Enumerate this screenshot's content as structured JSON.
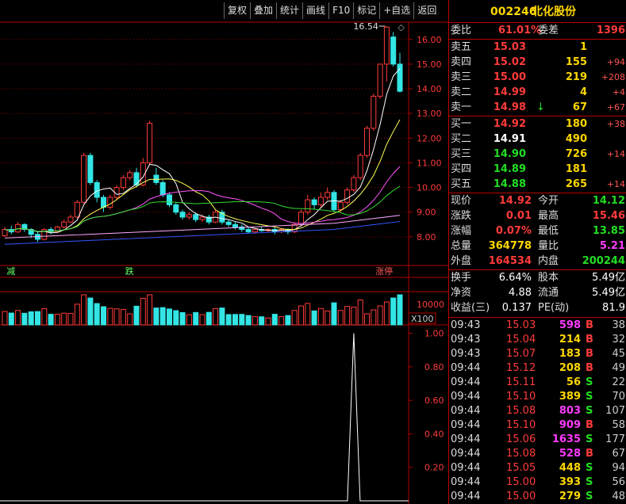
{
  "toolbar": [
    "复权",
    "叠加",
    "统计",
    "画线",
    "F10",
    "标记",
    "+自选",
    "返回"
  ],
  "stock": {
    "code": "002246",
    "name": "北化股份"
  },
  "weibi": {
    "label1": "委比",
    "value1": "61.01%",
    "label2": "委差",
    "value2": "1396"
  },
  "sells": [
    {
      "label": "卖五",
      "price": "15.03",
      "vol": "1",
      "chg": ""
    },
    {
      "label": "卖四",
      "price": "15.02",
      "vol": "155",
      "chg": "+94"
    },
    {
      "label": "卖三",
      "price": "15.00",
      "vol": "219",
      "chg": "+208"
    },
    {
      "label": "卖二",
      "price": "14.99",
      "vol": "4",
      "chg": "+4"
    },
    {
      "label": "卖一",
      "price": "14.98",
      "vol": "67",
      "chg": "+67",
      "arrow": "↓"
    }
  ],
  "buys": [
    {
      "label": "买一",
      "price": "14.92",
      "vol": "180",
      "chg": "+38"
    },
    {
      "label": "买二",
      "price": "14.91",
      "vol": "490",
      "chg": ""
    },
    {
      "label": "买三",
      "price": "14.90",
      "vol": "726",
      "chg": "+14"
    },
    {
      "label": "买四",
      "price": "14.89",
      "vol": "181",
      "chg": ""
    },
    {
      "label": "买五",
      "price": "14.88",
      "vol": "265",
      "chg": "+14"
    }
  ],
  "quote": {
    "xj_l": "现价",
    "xj": "14.92",
    "jk_l": "今开",
    "jk": "14.12",
    "zd_l": "涨跌",
    "zd": "0.01",
    "zg_l": "最高",
    "zg": "15.46",
    "zf_l": "涨幅",
    "zf": "0.07%",
    "zdi_l": "最低",
    "zdi": "13.85",
    "zl_l": "总量",
    "zl": "364778",
    "lb_l": "量比",
    "lb": "5.21",
    "wp_l": "外盘",
    "wp": "164534",
    "np_l": "内盘",
    "np": "200244"
  },
  "fund": {
    "hs_l": "换手",
    "hs": "6.64%",
    "gb_l": "股本",
    "gb": "5.49亿",
    "jz_l": "净资",
    "jz": "4.88",
    "lt_l": "流通",
    "lt": "5.49亿",
    "sy_l": "收益(三)",
    "sy": "0.137",
    "pe_l": "PE(动)",
    "pe": "81.9"
  },
  "ticks": [
    {
      "t": "09:43",
      "p": "15.03",
      "v": "598",
      "f": "B",
      "n": "38",
      "pc": "red",
      "vc": "magenta"
    },
    {
      "t": "09:43",
      "p": "15.04",
      "v": "214",
      "f": "B",
      "n": "32",
      "pc": "red",
      "vc": "yellow"
    },
    {
      "t": "09:43",
      "p": "15.07",
      "v": "183",
      "f": "B",
      "n": "45",
      "pc": "red",
      "vc": "yellow"
    },
    {
      "t": "09:44",
      "p": "15.12",
      "v": "208",
      "f": "B",
      "n": "49",
      "pc": "red",
      "vc": "yellow"
    },
    {
      "t": "09:44",
      "p": "15.11",
      "v": "56",
      "f": "S",
      "n": "22",
      "pc": "red",
      "vc": "yellow"
    },
    {
      "t": "09:44",
      "p": "15.10",
      "v": "389",
      "f": "S",
      "n": "70",
      "pc": "red",
      "vc": "yellow"
    },
    {
      "t": "09:44",
      "p": "15.08",
      "v": "803",
      "f": "S",
      "n": "107",
      "pc": "red",
      "vc": "magenta"
    },
    {
      "t": "09:44",
      "p": "15.10",
      "v": "909",
      "f": "B",
      "n": "58",
      "pc": "red",
      "vc": "magenta"
    },
    {
      "t": "09:44",
      "p": "15.06",
      "v": "1635",
      "f": "S",
      "n": "177",
      "pc": "red",
      "vc": "magenta"
    },
    {
      "t": "09:44",
      "p": "15.08",
      "v": "528",
      "f": "B",
      "n": "67",
      "pc": "red",
      "vc": "magenta"
    },
    {
      "t": "09:44",
      "p": "15.05",
      "v": "448",
      "f": "S",
      "n": "94",
      "pc": "red",
      "vc": "yellow"
    },
    {
      "t": "09:44",
      "p": "15.00",
      "v": "393",
      "f": "S",
      "n": "56",
      "pc": "red",
      "vc": "yellow"
    },
    {
      "t": "09:44",
      "p": "15.00",
      "v": "279",
      "f": "S",
      "n": "48",
      "pc": "red",
      "vc": "yellow"
    }
  ],
  "colors": {
    "up": "#ff3b3b",
    "down": "#33e5e5",
    "grid": "#8b0000",
    "axis": "#b00000"
  },
  "chart_data": {
    "type": "candlestick",
    "price_axis": {
      "ticks": [
        "8.00",
        "9.00",
        "10.00",
        "11.00",
        "12.00",
        "13.00",
        "14.00",
        "15.00",
        "16.00"
      ],
      "min": 7.0,
      "max": 16.7
    },
    "high_label": "16.54",
    "markers": [
      "减",
      "跌",
      "涨停"
    ],
    "candles": [
      [
        8.05,
        8.3,
        8.0,
        8.4
      ],
      [
        8.3,
        8.2,
        8.1,
        8.45
      ],
      [
        8.2,
        8.5,
        8.15,
        8.6
      ],
      [
        8.5,
        8.3,
        8.2,
        8.55
      ],
      [
        8.3,
        8.1,
        7.95,
        8.35
      ],
      [
        8.1,
        7.9,
        7.8,
        8.2
      ],
      [
        7.9,
        8.3,
        7.85,
        8.35
      ],
      [
        8.3,
        8.2,
        8.1,
        8.4
      ],
      [
        8.2,
        8.4,
        8.15,
        8.45
      ],
      [
        8.4,
        8.6,
        8.35,
        8.7
      ],
      [
        8.6,
        8.8,
        8.55,
        8.9
      ],
      [
        8.8,
        9.4,
        8.75,
        9.5
      ],
      [
        9.4,
        11.3,
        9.35,
        11.4
      ],
      [
        11.3,
        10.2,
        10.1,
        11.4
      ],
      [
        10.2,
        9.6,
        9.4,
        10.3
      ],
      [
        9.6,
        9.2,
        9.0,
        9.7
      ],
      [
        9.2,
        9.6,
        9.1,
        9.7
      ],
      [
        9.6,
        10.0,
        9.5,
        10.1
      ],
      [
        10.0,
        10.4,
        9.9,
        10.5
      ],
      [
        10.4,
        10.6,
        10.3,
        10.7
      ],
      [
        10.6,
        10.1,
        10.0,
        10.8
      ],
      [
        10.1,
        11.0,
        10.05,
        11.2
      ],
      [
        11.0,
        12.6,
        10.9,
        12.7
      ],
      [
        10.5,
        10.2,
        10.1,
        10.8
      ],
      [
        10.2,
        9.7,
        9.6,
        10.3
      ],
      [
        9.7,
        9.3,
        9.2,
        9.8
      ],
      [
        9.3,
        9.0,
        8.9,
        9.4
      ],
      [
        9.0,
        8.8,
        8.7,
        9.1
      ],
      [
        8.8,
        8.9,
        8.7,
        9.0
      ],
      [
        8.9,
        8.7,
        8.6,
        9.0
      ],
      [
        8.7,
        8.8,
        8.6,
        8.9
      ],
      [
        8.8,
        8.6,
        8.5,
        8.9
      ],
      [
        8.6,
        9.0,
        8.55,
        9.1
      ],
      [
        9.0,
        8.6,
        8.5,
        9.1
      ],
      [
        8.6,
        8.5,
        8.4,
        8.7
      ],
      [
        8.5,
        8.4,
        8.3,
        8.6
      ],
      [
        8.4,
        8.3,
        8.2,
        8.5
      ],
      [
        8.3,
        8.2,
        8.15,
        8.4
      ],
      [
        8.2,
        8.3,
        8.15,
        8.35
      ],
      [
        8.3,
        8.25,
        8.2,
        8.4
      ],
      [
        8.25,
        8.3,
        8.2,
        8.35
      ],
      [
        8.3,
        8.2,
        8.1,
        8.4
      ],
      [
        8.2,
        8.3,
        8.15,
        8.35
      ],
      [
        8.3,
        8.2,
        8.1,
        8.35
      ],
      [
        8.2,
        8.5,
        8.15,
        8.6
      ],
      [
        8.5,
        9.0,
        8.45,
        9.1
      ],
      [
        9.0,
        9.5,
        8.9,
        9.7
      ],
      [
        9.5,
        9.3,
        9.1,
        9.6
      ],
      [
        9.3,
        9.6,
        9.2,
        9.8
      ],
      [
        9.6,
        9.8,
        9.5,
        10.0
      ],
      [
        9.8,
        9.1,
        9.0,
        9.9
      ],
      [
        9.1,
        9.4,
        9.0,
        9.5
      ],
      [
        9.4,
        9.9,
        9.3,
        10.0
      ],
      [
        9.9,
        10.4,
        9.8,
        10.5
      ],
      [
        10.4,
        11.3,
        10.3,
        11.4
      ],
      [
        11.3,
        12.4,
        11.2,
        12.5
      ],
      [
        12.4,
        13.7,
        12.3,
        13.8
      ],
      [
        13.7,
        15.0,
        13.6,
        15.0
      ],
      [
        15.0,
        16.5,
        14.3,
        16.54
      ],
      [
        16.1,
        15.0,
        14.9,
        16.3
      ],
      [
        15.0,
        13.9,
        13.85,
        15.46
      ]
    ],
    "volume_axis": {
      "ticks": [
        "10000"
      ],
      "unit": "X100"
    },
    "indicator_axis": {
      "ticks": [
        "0.20",
        "0.40",
        "0.60",
        "0.80",
        "1.00"
      ],
      "min": 0,
      "max": 1.05,
      "spike_value": 1.0
    }
  }
}
